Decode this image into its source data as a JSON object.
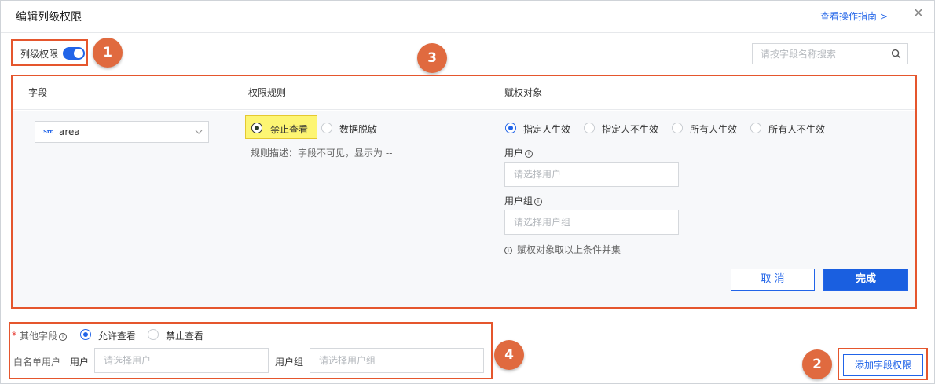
{
  "dialog": {
    "title": "编辑列级权限",
    "guide_link": "查看操作指南 >"
  },
  "column_permission": {
    "label": "列级权限",
    "enabled": true
  },
  "search": {
    "placeholder": "请按字段名称搜索"
  },
  "table": {
    "headers": {
      "field": "字段",
      "rule": "权限规则",
      "target": "赋权对象"
    },
    "row": {
      "field_type": "Str.",
      "field_value": "area",
      "rules": [
        {
          "label": "禁止查看",
          "selected": true
        },
        {
          "label": "数据脱敏",
          "selected": false
        }
      ],
      "rule_description": "规则描述：字段不可见，显示为 --",
      "targets": [
        {
          "label": "指定人生效",
          "selected": true
        },
        {
          "label": "指定人不生效",
          "selected": false
        },
        {
          "label": "所有人生效",
          "selected": false
        },
        {
          "label": "所有人不生效",
          "selected": false
        }
      ],
      "user_label": "用户",
      "user_placeholder": "请选择用户",
      "group_label": "用户组",
      "group_placeholder": "请选择用户组",
      "note": "赋权对象取以上条件并集",
      "cancel_label": "取 消",
      "done_label": "完成"
    }
  },
  "other_fields": {
    "required_mark": "*",
    "label": "其他字段",
    "options": [
      {
        "label": "允许查看",
        "selected": true
      },
      {
        "label": "禁止查看",
        "selected": false
      }
    ],
    "whitelist_label": "白名单用户",
    "user_label": "用户",
    "user_placeholder": "请选择用户",
    "group_label": "用户组",
    "group_placeholder": "请选择用户组"
  },
  "add_button_label": "添加字段权限",
  "annotations": [
    "1",
    "2",
    "3",
    "4"
  ],
  "colors": {
    "accent": "#2164e8",
    "annotation": "#e5562d",
    "highlight": "#fdf573"
  }
}
